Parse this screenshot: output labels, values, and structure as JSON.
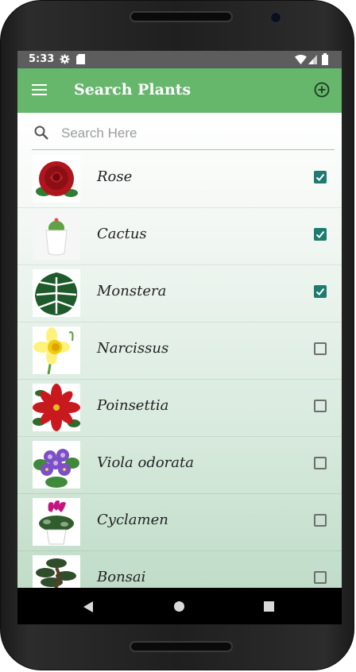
{
  "status": {
    "time": "5:33"
  },
  "appbar": {
    "title": "Search Plants"
  },
  "search": {
    "placeholder": "Search Here",
    "value": ""
  },
  "plants": [
    {
      "name": "Rose",
      "checked": true
    },
    {
      "name": "Cactus",
      "checked": true
    },
    {
      "name": "Monstera",
      "checked": true
    },
    {
      "name": "Narcissus",
      "checked": false
    },
    {
      "name": "Poinsettia",
      "checked": false
    },
    {
      "name": "Viola odorata",
      "checked": false
    },
    {
      "name": "Cyclamen",
      "checked": false
    },
    {
      "name": "Bonsai",
      "checked": false
    }
  ],
  "colors": {
    "appbar": "#66b66b",
    "checkbox_checked": "#1e7b70",
    "status_bar": "#5d5d5d"
  }
}
